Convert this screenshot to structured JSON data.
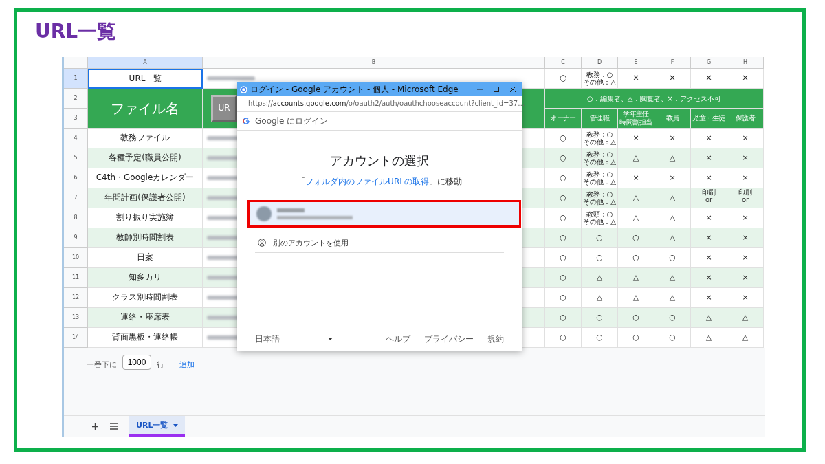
{
  "slide_title": "URL一覧",
  "sheet": {
    "column_headers": [
      "A",
      "B",
      "C",
      "D",
      "E",
      "F",
      "G",
      "H"
    ],
    "row_numbers": [
      "1",
      "2",
      "3",
      "4",
      "5",
      "6",
      "7",
      "8",
      "9",
      "10",
      "11",
      "12",
      "13",
      "14"
    ],
    "cell_a1": {
      "text": "URL一覧",
      "selected": true
    },
    "row1_permissions": [
      "○",
      "教務：○\nその他：△",
      "×",
      "×",
      "×",
      "×"
    ],
    "file_name_header": "ファイル名",
    "url_button": "UR",
    "legend": "○：編集者、△：閲覧者、×：アクセス不可",
    "roles": [
      {
        "lines": [
          "オーナー"
        ]
      },
      {
        "lines": [
          "管理職"
        ]
      },
      {
        "lines": [
          "学年主任",
          "時間割担当"
        ]
      },
      {
        "lines": [
          "教員"
        ]
      },
      {
        "lines": [
          "児童・生徒"
        ]
      },
      {
        "lines": [
          "保護者"
        ]
      }
    ],
    "rows": [
      {
        "name": "教務ファイル",
        "permissions": [
          "○",
          "教務：○\nその他：△",
          "×",
          "×",
          "×",
          "×"
        ]
      },
      {
        "name": "各種予定(職員公開)",
        "permissions": [
          "○",
          "教務：○\nその他：△",
          "△",
          "△",
          "×",
          "×"
        ]
      },
      {
        "name": "C4th・Googleカレンダー",
        "permissions": [
          "○",
          "教務：○\nその他：△",
          "×",
          "×",
          "×",
          "×"
        ]
      },
      {
        "name": "年間計画(保護者公開)",
        "permissions": [
          "○",
          "教務：○\nその他：△",
          "△",
          "△",
          "印刷\nor",
          "印刷\nor"
        ]
      },
      {
        "name": "割り振り実施簿",
        "permissions": [
          "○",
          "教頭：○\nその他：△",
          "△",
          "△",
          "×",
          "×"
        ]
      },
      {
        "name": "教師別時間割表",
        "permissions": [
          "○",
          "○",
          "○",
          "△",
          "×",
          "×"
        ]
      },
      {
        "name": "日案",
        "permissions": [
          "○",
          "○",
          "○",
          "○",
          "×",
          "×"
        ]
      },
      {
        "name": "知多カリ",
        "permissions": [
          "○",
          "△",
          "△",
          "△",
          "×",
          "×"
        ]
      },
      {
        "name": "クラス別時間割表",
        "permissions": [
          "○",
          "△",
          "△",
          "△",
          "×",
          "×"
        ]
      },
      {
        "name": "連絡・座席表",
        "permissions": [
          "○",
          "○",
          "○",
          "○",
          "△",
          "△"
        ]
      },
      {
        "name": "背面黒板・連絡帳",
        "permissions": [
          "○",
          "○",
          "○",
          "○",
          "△",
          "△"
        ]
      }
    ],
    "add_rows": {
      "prefix": "一番下に",
      "value": "1000",
      "suffix": "行",
      "button": "追加"
    },
    "sheet_tabs": [
      {
        "label": "URL一覧",
        "selected": true
      }
    ]
  },
  "dialog": {
    "title": "ログイン - Google アカウント - 個人 - Microsoft Edge",
    "url": "https://**accounts.google.com**/o/oauth2/auth/oauthchooseaccount?client_id=37…",
    "page_header": "Google にログイン",
    "heading": "アカウントの選択",
    "subtitle_open": "「",
    "subtitle_link": "フォルダ内のファイルURLの取得",
    "subtitle_close": "」に移動",
    "account": {
      "highlighted": true
    },
    "other_account": "別のアカウントを使用",
    "language": "日本語",
    "footer_links": [
      "ヘルプ",
      "プライバシー",
      "規約"
    ]
  }
}
